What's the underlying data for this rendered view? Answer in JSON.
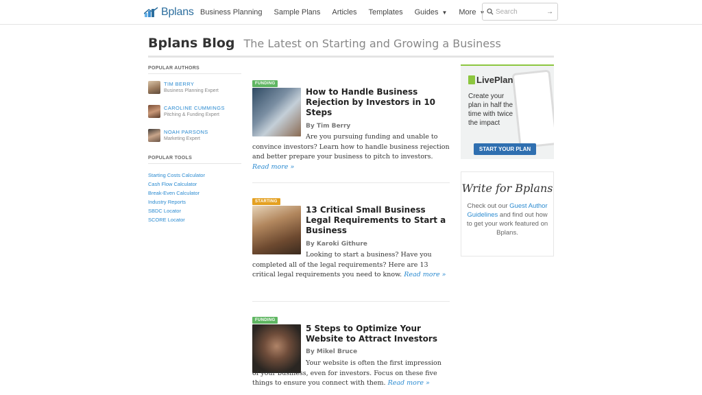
{
  "header": {
    "logo_text": "Bplans",
    "nav": [
      {
        "label": "Business Planning",
        "dropdown": false
      },
      {
        "label": "Sample Plans",
        "dropdown": false
      },
      {
        "label": "Articles",
        "dropdown": false
      },
      {
        "label": "Templates",
        "dropdown": false
      },
      {
        "label": "Guides",
        "dropdown": true
      },
      {
        "label": "More",
        "dropdown": true
      }
    ],
    "search_placeholder": "Search"
  },
  "page": {
    "title": "Bplans Blog",
    "subtitle": "The Latest on Starting and Growing a Business"
  },
  "sidebar": {
    "authors_heading": "POPULAR AUTHORS",
    "authors": [
      {
        "name": "TIM BERRY",
        "role": "Business Planning Expert"
      },
      {
        "name": "CAROLINE CUMMINGS",
        "role": "Pitching & Funding Expert"
      },
      {
        "name": "NOAH PARSONS",
        "role": "Marketing Expert"
      }
    ],
    "tools_heading": "POPULAR TOOLS",
    "tools": [
      "Starting Costs Calculator",
      "Cash Flow Calculator",
      "Break-Even Calculator",
      "Industry Reports",
      "SBDC Locator",
      "SCORE Locator"
    ]
  },
  "posts": [
    {
      "category": "FUNDING",
      "title": "How to Handle Business Rejection by Investors in 10 Steps",
      "byline": "By Tim Berry",
      "excerpt": "Are you pursuing funding and unable to convince investors? Learn how to handle business rejection and better prepare your business to pitch to investors.",
      "read_more": "Read more »"
    },
    {
      "category": "STARTING",
      "title": "13 Critical Small Business Legal Requirements to Start a Business",
      "byline": "By Karoki Githure",
      "excerpt": "Looking to start a business? Have you completed all of the legal requirements? Here are 13 critical legal requirements you need to know.",
      "read_more": "Read more »"
    },
    {
      "category": "FUNDING",
      "title": "5 Steps to Optimize Your Website to Attract Investors",
      "byline": "By Mikel Bruce",
      "excerpt": "Your website is often the first impression of your business, even for investors. Focus on these five things to ensure you connect with them.",
      "read_more": "Read more »"
    }
  ],
  "ad": {
    "brand": "LivePlan",
    "copy": "Create your plan in half the time with twice the impact",
    "cta": "START YOUR PLAN"
  },
  "write_box": {
    "title": "Write for Bplans",
    "text_before": "Check out our ",
    "link": "Guest Author Guidelines",
    "text_after": " and find out how to get your work featured on Bplans."
  }
}
